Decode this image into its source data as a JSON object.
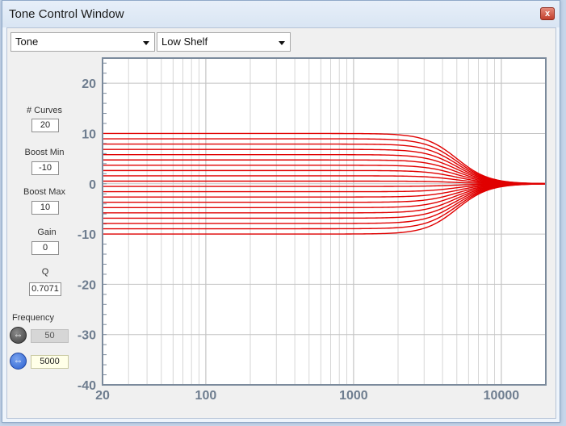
{
  "window": {
    "title": "Tone Control Window",
    "close_label": "x"
  },
  "toolbar": {
    "filter_select": "Tone",
    "shape_select": "Low Shelf"
  },
  "controls": {
    "curves_label": "# Curves",
    "curves_value": "20",
    "boost_min_label": "Boost Min",
    "boost_min_value": "-10",
    "boost_max_label": "Boost Max",
    "boost_max_value": "10",
    "gain_label": "Gain",
    "gain_value": "0",
    "q_label": "Q",
    "q_value": "0.7071",
    "frequency_label": "Frequency",
    "freq_low_value": "50",
    "freq_high_value": "5000",
    "freq_low_icon": "swap-arrows-icon",
    "freq_high_icon": "swap-arrows-icon"
  },
  "chart_data": {
    "type": "line",
    "x_scale": "log",
    "xlim": [
      20,
      20000
    ],
    "ylim": [
      -40,
      25
    ],
    "x_ticks": [
      {
        "value": 20,
        "label": "20"
      },
      {
        "value": 100,
        "label": "100"
      },
      {
        "value": 1000,
        "label": "1000"
      },
      {
        "value": 10000,
        "label": "10000"
      }
    ],
    "y_ticks": [
      {
        "value": 20,
        "label": "20"
      },
      {
        "value": 10,
        "label": "10"
      },
      {
        "value": 0,
        "label": "0"
      },
      {
        "value": -10,
        "label": "-10"
      },
      {
        "value": -20,
        "label": "-20"
      },
      {
        "value": -30,
        "label": "-30"
      },
      {
        "value": -40,
        "label": "-40"
      }
    ],
    "grid": true,
    "curves": 20,
    "gain_min": -10,
    "gain_max": 10,
    "corner_frequency": 5000,
    "q": 0.7071,
    "line_color": "#e00000",
    "grid_color": "#cccccc",
    "axis_color": "#7b8a9c"
  }
}
